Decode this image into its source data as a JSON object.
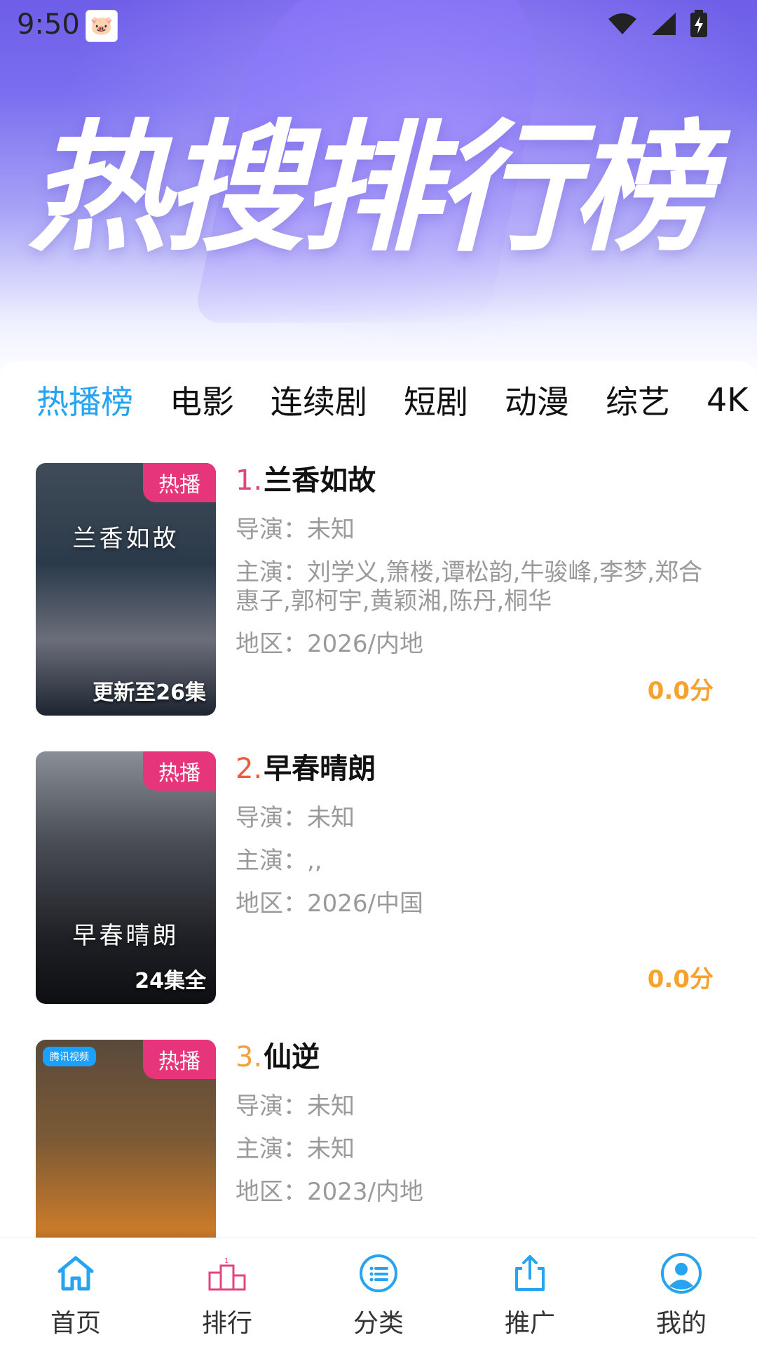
{
  "status": {
    "time": "9:50"
  },
  "hero": {
    "title": "热搜排行榜"
  },
  "tabs": [
    {
      "label": "热播榜"
    },
    {
      "label": "电影"
    },
    {
      "label": "连续剧"
    },
    {
      "label": "短剧"
    },
    {
      "label": "动漫"
    },
    {
      "label": "综艺"
    },
    {
      "label": "4K"
    }
  ],
  "items": [
    {
      "rank": "1.",
      "title": "兰香如故",
      "badge": "热播",
      "poster_title": "兰香如故",
      "episodes": "更新至26集",
      "director": "导演：未知",
      "cast": "主演：刘学义,箫楼,谭松韵,牛骏峰,李梦,郑合惠子,郭柯宇,黄颖湘,陈丹,桐华",
      "region": "地区：2026/内地",
      "score": "0.0分"
    },
    {
      "rank": "2.",
      "title": "早春晴朗",
      "badge": "热播",
      "poster_title": "早春晴朗",
      "episodes": "24集全",
      "director": "导演：未知",
      "cast": "主演：,,",
      "region": "地区：2026/中国",
      "score": "0.0分"
    },
    {
      "rank": "3.",
      "title": "仙逆",
      "badge": "热播",
      "poster_logo": "腾讯视频",
      "director": "导演：未知",
      "cast": "主演：未知",
      "region": "地区：2023/内地"
    }
  ],
  "nav": [
    {
      "label": "首页",
      "icon": "home-icon",
      "active": true
    },
    {
      "label": "排行",
      "icon": "podium-icon"
    },
    {
      "label": "分类",
      "icon": "list-icon"
    },
    {
      "label": "推广",
      "icon": "share-icon"
    },
    {
      "label": "我的",
      "icon": "user-icon"
    }
  ],
  "colors": {
    "accent": "#26a4ef",
    "badge": "#e6357b",
    "score": "#f7a22f",
    "rank1": "#e1457f",
    "rank2": "#ef5a3e",
    "rank3": "#f2a13a"
  }
}
